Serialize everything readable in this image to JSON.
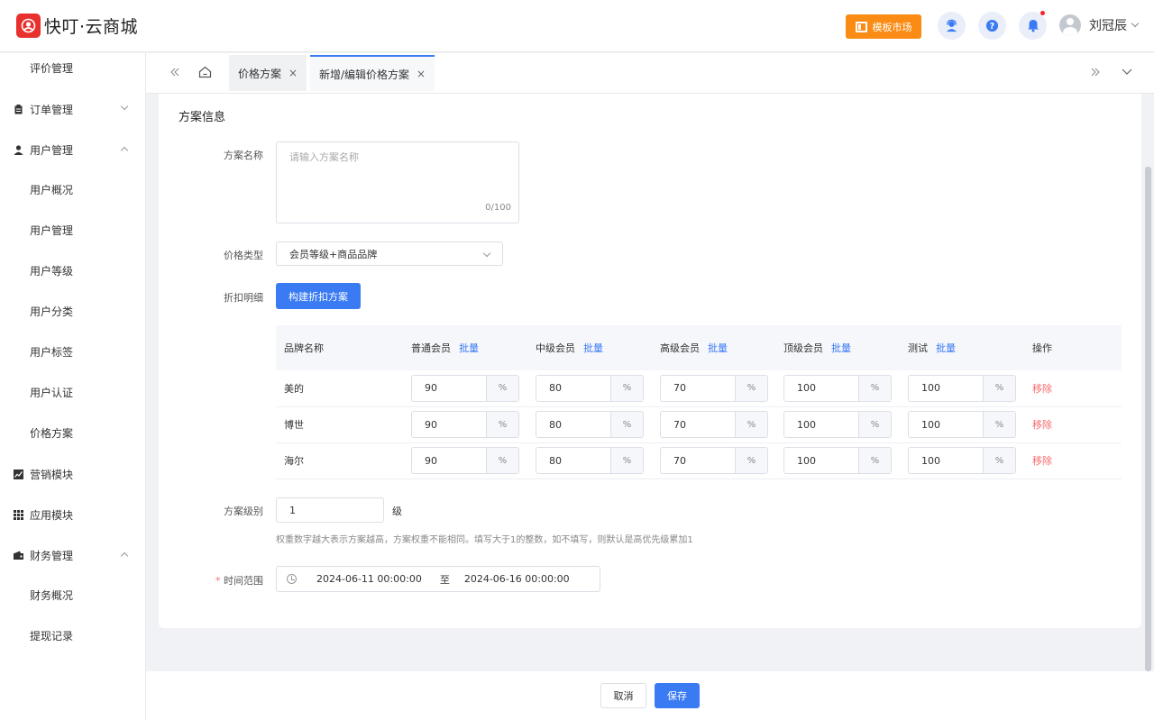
{
  "brand": {
    "name": "快叮·云商城",
    "accent": "#3a7af3",
    "logo_color": "#e8312f"
  },
  "header": {
    "market_label": "模板市场",
    "user_name": "刘冠辰",
    "icons": [
      "support-icon",
      "help-icon",
      "bell-icon"
    ]
  },
  "sidebar": {
    "items": [
      {
        "label": "评价管理",
        "type": "sub"
      },
      {
        "label": "订单管理",
        "type": "group",
        "icon": "clipboard-icon",
        "state": "collapsed"
      },
      {
        "label": "用户管理",
        "type": "group",
        "icon": "user-icon",
        "state": "expanded"
      },
      {
        "label": "用户概况",
        "type": "sub"
      },
      {
        "label": "用户管理",
        "type": "sub"
      },
      {
        "label": "用户等级",
        "type": "sub"
      },
      {
        "label": "用户分类",
        "type": "sub"
      },
      {
        "label": "用户标签",
        "type": "sub"
      },
      {
        "label": "用户认证",
        "type": "sub"
      },
      {
        "label": "价格方案",
        "type": "sub"
      },
      {
        "label": "营销模块",
        "type": "group",
        "icon": "chart-icon"
      },
      {
        "label": "应用模块",
        "type": "group",
        "icon": "grid-icon"
      },
      {
        "label": "财务管理",
        "type": "group",
        "icon": "wallet-icon",
        "state": "expanded"
      },
      {
        "label": "财务概况",
        "type": "sub"
      },
      {
        "label": "提现记录",
        "type": "sub"
      }
    ]
  },
  "tabs": [
    {
      "label": "价格方案",
      "active": false
    },
    {
      "label": "新增/编辑价格方案",
      "active": true
    }
  ],
  "form": {
    "section_title": "方案信息",
    "name": {
      "label": "方案名称",
      "placeholder": "请输入方案名称",
      "counter": "0/100"
    },
    "price_type": {
      "label": "价格类型",
      "value": "会员等级+商品品牌"
    },
    "discount": {
      "label": "折扣明细",
      "build_button": "构建折扣方案"
    },
    "table": {
      "brand_header": "品牌名称",
      "action_header": "操作",
      "batch_label": "批量",
      "unit": "%",
      "remove_label": "移除",
      "levels": [
        "普通会员",
        "中级会员",
        "高级会员",
        "顶级会员",
        "测试"
      ],
      "rows": [
        {
          "brand": "美的",
          "values": [
            "90",
            "80",
            "70",
            "100",
            "100"
          ]
        },
        {
          "brand": "博世",
          "values": [
            "90",
            "80",
            "70",
            "100",
            "100"
          ]
        },
        {
          "brand": "海尔",
          "values": [
            "90",
            "80",
            "70",
            "100",
            "100"
          ]
        }
      ]
    },
    "level": {
      "label": "方案级别",
      "value": "1",
      "unit": "级",
      "hint": "权重数字越大表示方案越高，方案权重不能相同。填写大于1的整数，如不填写，则默认是高优先级累加1"
    },
    "time_range": {
      "label": "时间范围",
      "start": "2024-06-11 00:00:00",
      "separator": "至",
      "end": "2024-06-16 00:00:00"
    }
  },
  "footer": {
    "cancel_label": "取消",
    "save_label": "保存"
  }
}
